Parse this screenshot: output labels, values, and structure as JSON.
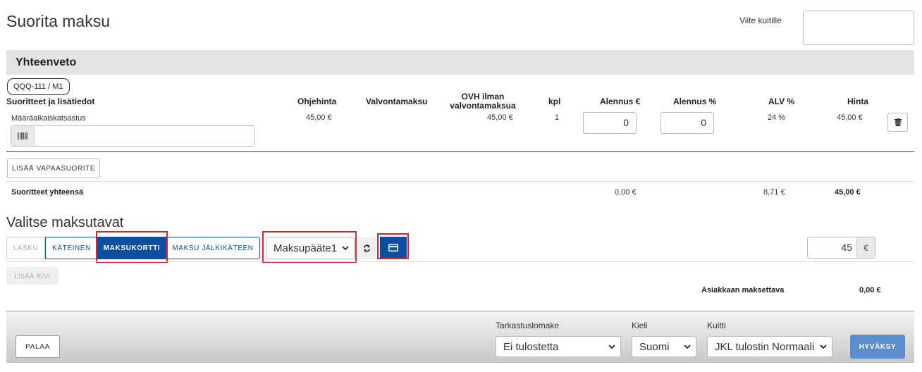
{
  "page": {
    "title": "Suorita maksu"
  },
  "reference": {
    "label": "Viite kuitille",
    "value": ""
  },
  "summary": {
    "heading": "Yhteenveto",
    "vehicle_tag": "QQQ-111 / M1",
    "columns": {
      "services": "Suoritteet ja lisätiedot",
      "list_price": "Ohjehinta",
      "control_fee": "Valvontamaksu",
      "ovh_line1": "OVH ilman",
      "ovh_line2": "valvontamaksua",
      "qty": "kpl",
      "discount_eur": "Alennus €",
      "discount_pct": "Alennus %",
      "vat": "ALV %",
      "price": "Hinta"
    },
    "row": {
      "name": "Määräaikaiskatsastus",
      "list_price": "45,00 €",
      "control_fee": "",
      "ovh": "45,00 €",
      "qty": "1",
      "discount_eur": "0",
      "discount_pct": "0",
      "vat": "24 %",
      "price": "45,00 €",
      "barcode_value": ""
    },
    "add_free_service": "LISÄÄ VAPAASUORITE",
    "totals": {
      "label": "Suoritteet yhteensä",
      "discount": "0,00 €",
      "vat": "8,71 €",
      "price": "45,00 €"
    }
  },
  "payment": {
    "heading": "Valitse maksutavat",
    "tabs": [
      "LASKU",
      "KÄTEINEN",
      "MAKSUKORTTI",
      "MAKSU JÄLKIKÄTEEN"
    ],
    "active_tab": "MAKSUKORTTI",
    "terminal": "Maksupääte1",
    "amount": "45",
    "currency": "€",
    "add_row": "LISÄÄ RIVI",
    "customer_pays_label": "Asiakkaan maksettava",
    "customer_pays_value": "0,00 €"
  },
  "footer": {
    "back": "PALAA",
    "inspection_form_label": "Tarkastuslomake",
    "inspection_form_value": "Ei tulostetta",
    "language_label": "Kieli",
    "language_value": "Suomi",
    "receipt_label": "Kuitti",
    "receipt_value": "JKL tulostin Normaali",
    "approve": "HYVÄKSY"
  },
  "colors": {
    "primary": "#0b4fa0",
    "highlight": "#d9242f",
    "approve": "#5b8ccc"
  },
  "icons": [
    "barcode-icon",
    "trash-icon",
    "refresh-icon",
    "credit-card-icon",
    "chevron-down-icon"
  ]
}
